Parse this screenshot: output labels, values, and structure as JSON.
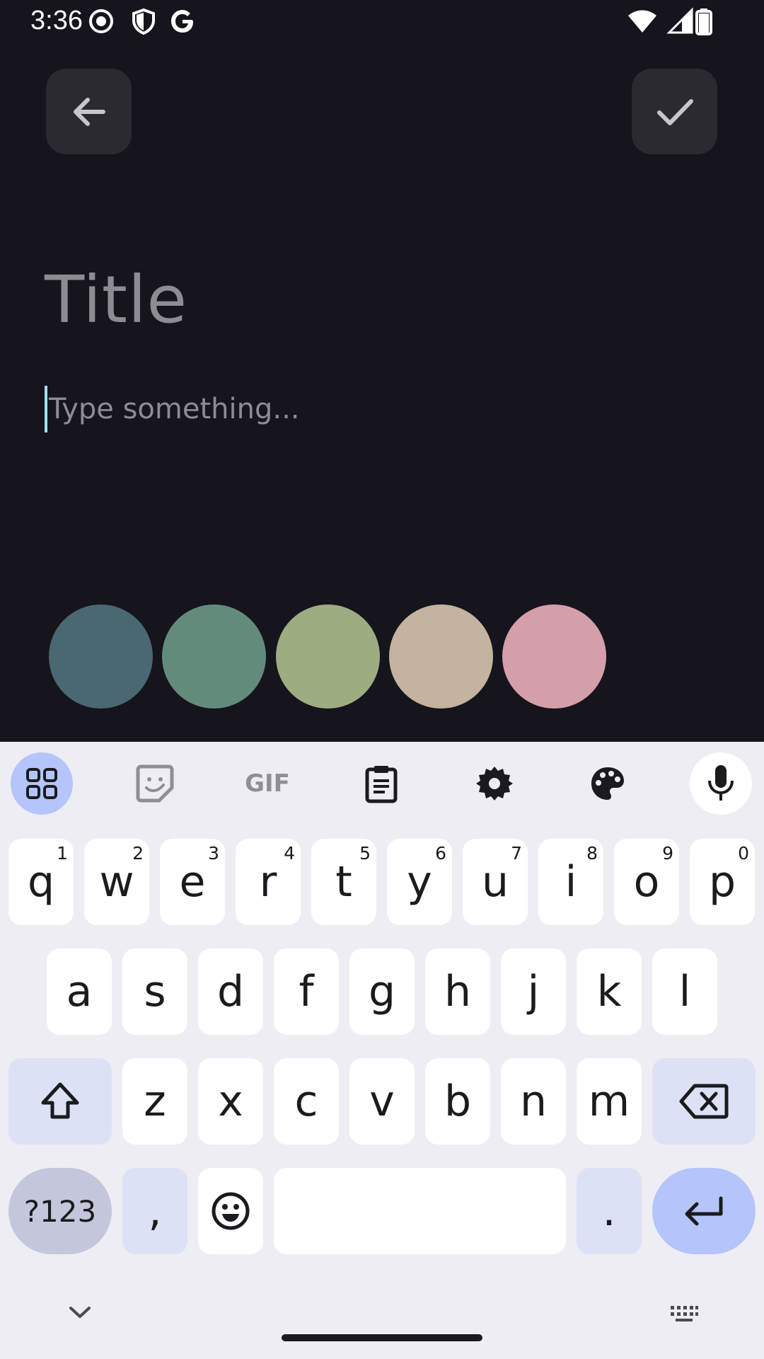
{
  "status_bar": {
    "time": "3:36",
    "left_icons": [
      "screen-record-icon",
      "shield-icon",
      "google-g-icon"
    ],
    "right_icons": [
      "wifi-icon",
      "signal-icon",
      "battery-icon"
    ]
  },
  "toolbar": {
    "back_icon": "arrow-left-icon",
    "save_icon": "check-icon"
  },
  "editor": {
    "title_placeholder": "Title",
    "body_placeholder": "Type something..."
  },
  "color_palette": [
    "#4a6872",
    "#638b7c",
    "#9eac82",
    "#c3b39f",
    "#d49faa"
  ],
  "colors": {
    "background": "#16141c",
    "button_bg": "#2b2a31",
    "cursor": "#9fe3ef",
    "keyboard_bg": "#efedf4",
    "key_bg": "#ffffff",
    "mod_key_bg": "#dde1f5",
    "accent": "#b3c5fa"
  },
  "keyboard": {
    "toolbar": [
      "apps-grid-icon",
      "sticker-icon",
      "gif-icon",
      "clipboard-icon",
      "settings-gear-icon",
      "palette-icon",
      "microphone-icon"
    ],
    "gif_label": "GIF",
    "row1": [
      {
        "letter": "q",
        "hint": "1"
      },
      {
        "letter": "w",
        "hint": "2"
      },
      {
        "letter": "e",
        "hint": "3"
      },
      {
        "letter": "r",
        "hint": "4"
      },
      {
        "letter": "t",
        "hint": "5"
      },
      {
        "letter": "y",
        "hint": "6"
      },
      {
        "letter": "u",
        "hint": "7"
      },
      {
        "letter": "i",
        "hint": "8"
      },
      {
        "letter": "o",
        "hint": "9"
      },
      {
        "letter": "p",
        "hint": "0"
      }
    ],
    "row2": [
      "a",
      "s",
      "d",
      "f",
      "g",
      "h",
      "j",
      "k",
      "l"
    ],
    "row3": [
      "z",
      "x",
      "c",
      "v",
      "b",
      "n",
      "m"
    ],
    "symbols_label": "?123",
    "comma_label": ",",
    "period_label": ".",
    "bottom_icons": [
      "chevron-down-icon",
      "keyboard-icon"
    ]
  }
}
